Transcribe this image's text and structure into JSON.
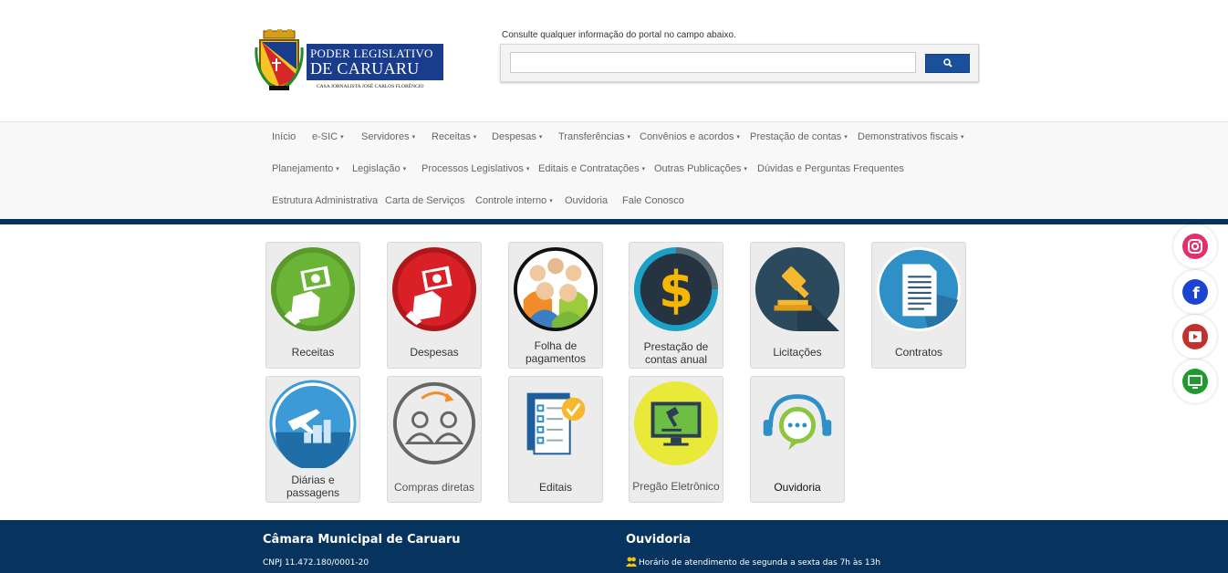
{
  "header": {
    "logo_line1": "PODER LEGISLATIVO",
    "logo_line2": "DE CARUARU",
    "logo_subtitle": "CASA JORNALISTA JOSÉ CARLOS FLORÊNCIO",
    "search_hint": "Consulte qualquer informação do portal no campo abaixo.",
    "search_value": "",
    "search_icon": "search-icon"
  },
  "nav": {
    "row1": [
      {
        "label": "Início",
        "dropdown": false
      },
      {
        "label": "e-SIC",
        "dropdown": true
      },
      {
        "label": "Servidores",
        "dropdown": true
      },
      {
        "label": "Receitas",
        "dropdown": true
      },
      {
        "label": "Despesas",
        "dropdown": true
      },
      {
        "label": "Transferências",
        "dropdown": true
      },
      {
        "label": "Convênios e acordos",
        "dropdown": true
      },
      {
        "label": "Prestação de contas",
        "dropdown": true
      },
      {
        "label": "Demonstrativos fiscais",
        "dropdown": true
      }
    ],
    "row2": [
      {
        "label": "Planejamento",
        "dropdown": true
      },
      {
        "label": "Legislação",
        "dropdown": true
      },
      {
        "label": "Processos Legislativos",
        "dropdown": true
      },
      {
        "label": "Editais e Contratações",
        "dropdown": true
      },
      {
        "label": "Outras Publicações",
        "dropdown": true
      },
      {
        "label": "Dúvidas e Perguntas Frequentes",
        "dropdown": false
      }
    ],
    "row3": [
      {
        "label": "Estrutura Administrativa",
        "dropdown": false
      },
      {
        "label": "Carta de Serviços",
        "dropdown": false
      },
      {
        "label": "Controle interno",
        "dropdown": true
      },
      {
        "label": "Ouvidoria",
        "dropdown": false
      },
      {
        "label": "Fale Conosco",
        "dropdown": false
      }
    ],
    "caret": "▾"
  },
  "tiles": [
    {
      "label": "Receitas",
      "icon": "money-hand-icon"
    },
    {
      "label": "Despesas",
      "icon": "money-hand-icon"
    },
    {
      "label": "Folha de pagamentos",
      "icon": "people-group-icon"
    },
    {
      "label": "Prestação de contas anual",
      "icon": "dollar-icon"
    },
    {
      "label": "Licitações",
      "icon": "gavel-icon"
    },
    {
      "label": "Contratos",
      "icon": "document-icon"
    },
    {
      "label": "Diárias e passagens",
      "icon": "plane-city-icon"
    },
    {
      "label": "Compras diretas",
      "icon": "people-transfer-icon"
    },
    {
      "label": "Editais",
      "icon": "checklist-icon"
    },
    {
      "label": "Pregão Eletrônico",
      "icon": "online-auction-icon"
    },
    {
      "label": "Ouvidoria",
      "icon": "headset-chat-icon"
    }
  ],
  "social": [
    {
      "name": "instagram",
      "icon": "instagram-icon",
      "color": "#e1306c"
    },
    {
      "name": "facebook",
      "icon": "facebook-icon",
      "color": "#1d44d1"
    },
    {
      "name": "youtube",
      "icon": "youtube-icon",
      "color": "#c4302b"
    },
    {
      "name": "tv",
      "icon": "tv-icon",
      "color": "#1f9a2e"
    }
  ],
  "footer": {
    "left_title": "Câmara Municipal de Caruaru",
    "left_cnpj": "CNPJ 11.472.180/0001-20",
    "right_title": "Ouvidoria",
    "right_hours": "Horário de atendimento de segunda a sexta das 7h às 13h"
  },
  "colors": {
    "brand_navy": "#07335f",
    "search_button": "#1a4f9c"
  }
}
